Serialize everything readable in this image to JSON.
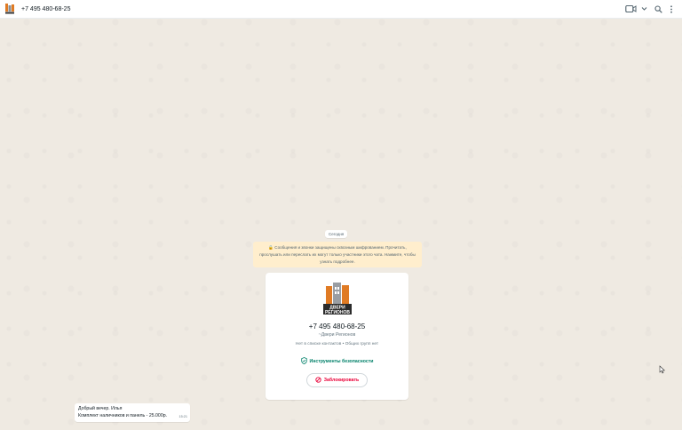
{
  "header": {
    "title": "+7 495 480-68-25",
    "icons": [
      "video-call-icon",
      "chevron-down-icon",
      "search-icon",
      "menu-icon"
    ]
  },
  "chat": {
    "date_label": "Сегодня",
    "encryption_notice": "🔒 Сообщения и звонки защищены сквозным шифрованием. Прочитать, прослушать или переслать их могут только участники этого чата. Нажмите, чтобы узнать подробнее.",
    "contact_card": {
      "logo_text": "Двери Регионов",
      "phone": "+7 495 480-68-25",
      "name": "~Двери Регионов",
      "meta": "Нет в списке контактов • Общих групп нет",
      "security_label": "Инструменты безопасности",
      "block_label": "Заблокировать"
    },
    "message": {
      "line1": "Добрый вечер. Илья",
      "line2": "Комплект наличников и панель - 25.000р.",
      "time": "15:21"
    }
  },
  "colors": {
    "accent": "#008069",
    "danger": "#ea0038",
    "notice_bg": "#ffeecd",
    "chat_bg": "#efeae2",
    "logo_orange": "#e07b24"
  }
}
